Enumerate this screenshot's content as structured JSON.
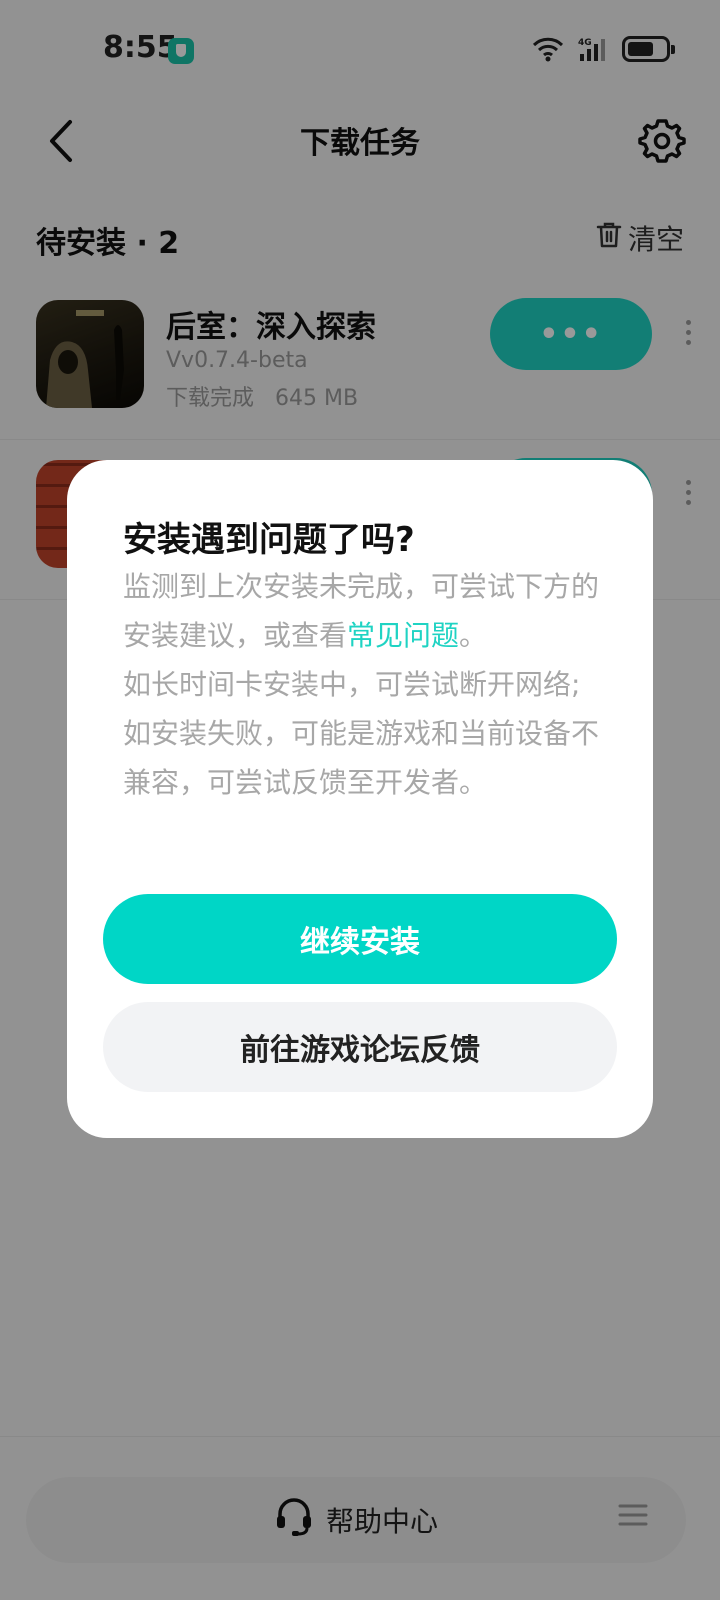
{
  "status_bar": {
    "time": "8:55",
    "network_label": "4G",
    "battery_level": 0.7,
    "vpn_icon": "vpn-shield-icon"
  },
  "header": {
    "title": "下载任务",
    "back_icon": "chevron-left-icon",
    "settings_icon": "gear-icon"
  },
  "section": {
    "title": "待安装 · 2",
    "clear_label": "清空",
    "clear_icon": "trash-icon"
  },
  "tasks": [
    {
      "name": "后室：深入探索",
      "version": "Vv0.7.4-beta",
      "status": "下载完成",
      "size": "645 MB",
      "action_label": "•••"
    },
    {
      "name": "",
      "version": "",
      "status": "",
      "size": "",
      "action_label": ""
    }
  ],
  "dialog": {
    "title": "安装遇到问题了吗?",
    "body_part1": "监测到上次安装未完成，可尝试下方的安装建议，或查看",
    "body_link": "常见问题",
    "body_part2": "。",
    "body_line2": "如长时间卡安装中，可尝试断开网络;",
    "body_line3": "如安装失败，可能是游戏和当前设备不兼容，可尝试反馈至开发者。",
    "primary_button": "继续安装",
    "secondary_button": "前往游戏论坛反馈"
  },
  "bottom": {
    "help_label": "帮助中心",
    "help_icon": "headset-icon",
    "menu_icon": "menu-icon"
  },
  "colors": {
    "accent": "#1fd3c3",
    "primary_button": "#00d6c6",
    "secondary_button": "#f2f3f5"
  }
}
